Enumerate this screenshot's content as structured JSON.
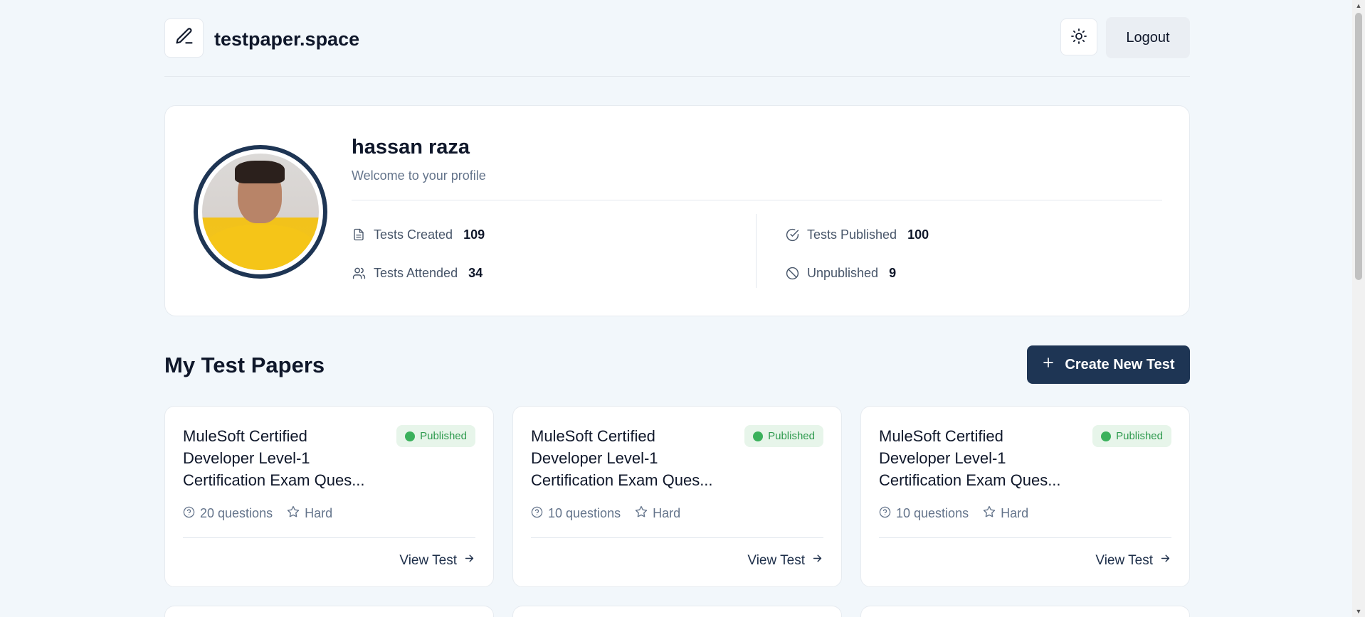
{
  "header": {
    "brand": "testpaper.space",
    "logout_label": "Logout"
  },
  "profile": {
    "name": "hassan raza",
    "subtitle": "Welcome to your profile",
    "stats": {
      "tests_created_label": "Tests Created",
      "tests_created_value": "109",
      "tests_attended_label": "Tests Attended",
      "tests_attended_value": "34",
      "tests_published_label": "Tests Published",
      "tests_published_value": "100",
      "unpublished_label": "Unpublished",
      "unpublished_value": "9"
    }
  },
  "section": {
    "title": "My Test Papers",
    "create_label": "Create New Test"
  },
  "tests": [
    {
      "title": "MuleSoft Certified Developer Level-1 Certification Exam Ques...",
      "status": "Published",
      "questions": "20 questions",
      "difficulty": "Hard",
      "view_label": "View Test"
    },
    {
      "title": "MuleSoft Certified Developer Level-1 Certification Exam Ques...",
      "status": "Published",
      "questions": "10 questions",
      "difficulty": "Hard",
      "view_label": "View Test"
    },
    {
      "title": "MuleSoft Certified Developer Level-1 Certification Exam Ques...",
      "status": "Published",
      "questions": "10 questions",
      "difficulty": "Hard",
      "view_label": "View Test"
    }
  ],
  "icons": {
    "logo": "pencil-icon",
    "theme": "sun-icon",
    "tests_created": "file-text-icon",
    "tests_attended": "users-icon",
    "tests_published": "check-circle-icon",
    "unpublished": "ban-icon",
    "questions": "help-circle-icon",
    "difficulty": "star-icon",
    "view": "arrow-right-icon",
    "create": "plus-icon"
  },
  "colors": {
    "background": "#f2f7fb",
    "primary": "#1e3554",
    "published_badge_bg": "#e7f5ea",
    "published_badge_text": "#2e9a4e"
  }
}
